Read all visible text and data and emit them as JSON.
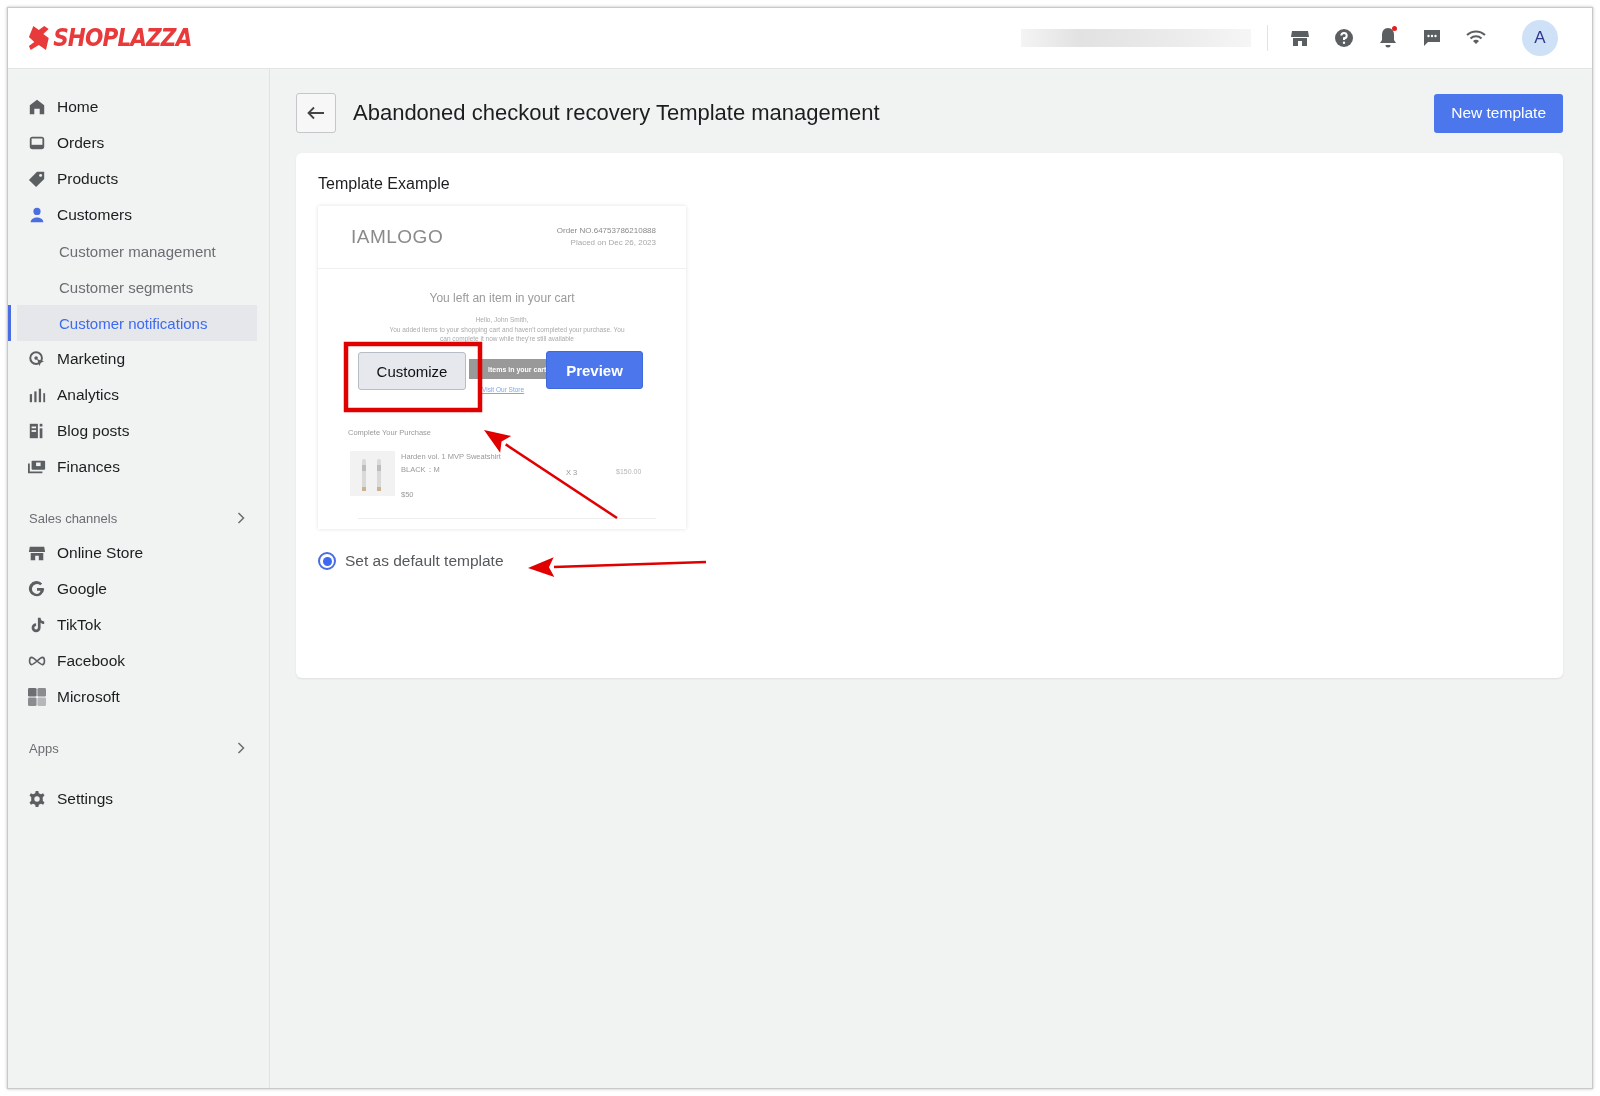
{
  "header": {
    "logo": "SHOPLAZZA",
    "avatar": "A",
    "notification_unread": true
  },
  "sidebar": {
    "sections": [
      {
        "items": [
          {
            "label": "Home",
            "kind": "home",
            "selected": false
          },
          {
            "label": "Orders",
            "kind": "orders",
            "selected": false
          },
          {
            "label": "Products",
            "kind": "products",
            "selected": false
          },
          {
            "label": "Customers",
            "kind": "customers",
            "selected": false,
            "children": [
              {
                "label": "Customer management",
                "selected": false
              },
              {
                "label": "Customer segments",
                "selected": false
              },
              {
                "label": "Customer notifications",
                "selected": true
              }
            ]
          },
          {
            "label": "Marketing",
            "kind": "marketing",
            "selected": false
          },
          {
            "label": "Analytics",
            "kind": "analytics",
            "selected": false
          },
          {
            "label": "Blog posts",
            "kind": "blog",
            "selected": false
          },
          {
            "label": "Finances",
            "kind": "finances",
            "selected": false
          }
        ]
      },
      {
        "title": "Sales channels",
        "items": [
          {
            "label": "Online Store",
            "kind": "store",
            "selected": false
          },
          {
            "label": "Google",
            "kind": "google",
            "selected": false
          },
          {
            "label": "TikTok",
            "kind": "tiktok",
            "selected": false
          },
          {
            "label": "Facebook",
            "kind": "facebook",
            "selected": false
          },
          {
            "label": "Microsoft",
            "kind": "microsoft",
            "selected": false
          }
        ]
      },
      {
        "title": "Apps"
      },
      {
        "items": [
          {
            "label": "Settings",
            "kind": "settings",
            "selected": false
          }
        ]
      }
    ]
  },
  "page": {
    "title": "Abandoned checkout recovery Template management",
    "new_button": "New template",
    "card": {
      "heading": "Template Example",
      "template_preview": {
        "logo": "IAMLOGO",
        "order_no": "Order NO.64753786210888",
        "placed": "Placed on Dec 26, 2023",
        "headline": "You left an item in your cart",
        "greeting": "Hello, John Smith,",
        "message": "You added items to your shopping cart and haven't completed your purchase. You can complete it now while they're still available",
        "cart_button": "Items in your cart",
        "link": "Visit Our Store",
        "section_title": "Complete Your Purchase",
        "product": {
          "name": "Harden vol. 1 MVP Sweatshirt",
          "variant": "BLACK：M",
          "price": "$50",
          "quantity": "X 3",
          "total": "$150.00"
        }
      },
      "overlay_buttons": [
        {
          "label": "Customize",
          "kind": "secondary"
        },
        {
          "label": "Preview",
          "kind": "primary"
        }
      ],
      "default_option": {
        "label": "Set as default template",
        "selected": true
      }
    }
  },
  "annotations": [
    {
      "kind": "frame"
    },
    {
      "kind": "arrow"
    },
    {
      "kind": "arrow"
    }
  ]
}
